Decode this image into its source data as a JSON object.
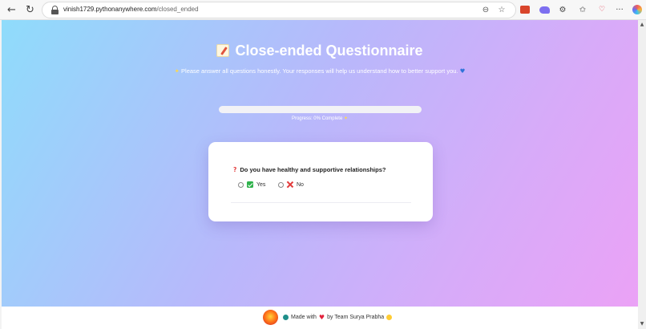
{
  "browser": {
    "url_host": "vinish1729.pythonanywhere.com",
    "url_path": "/closed_ended",
    "back_glyph": "←",
    "reload_glyph": "↻",
    "zoom_glyph": "⊖",
    "favorite_glyph": "☆",
    "extensions_glyph": "⚙",
    "favorites_glyph": "✩",
    "more_glyph": "···"
  },
  "page": {
    "title": "Close-ended Questionnaire",
    "subtitle": "Please answer all questions honestly. Your responses will help us understand how to better support you.",
    "progress_label": "Progress: 0% Complete",
    "progress_value": 0,
    "accent_color": "#7c6cf0"
  },
  "question": {
    "text": "Do you have healthy and supportive relationships?",
    "options": [
      {
        "label": "Yes",
        "selected": false
      },
      {
        "label": "No",
        "selected": false
      }
    ]
  },
  "footer": {
    "made_with": "Made with",
    "by_team": "by Team Surya Prabha"
  },
  "icons": [
    "back-arrow-icon",
    "reload-icon",
    "lock-icon",
    "zoom-icon",
    "star-icon",
    "memo-icon",
    "sparkle-icon",
    "blue-heart-icon",
    "red-heart-icon",
    "check-icon",
    "cross-icon",
    "question-icon"
  ]
}
